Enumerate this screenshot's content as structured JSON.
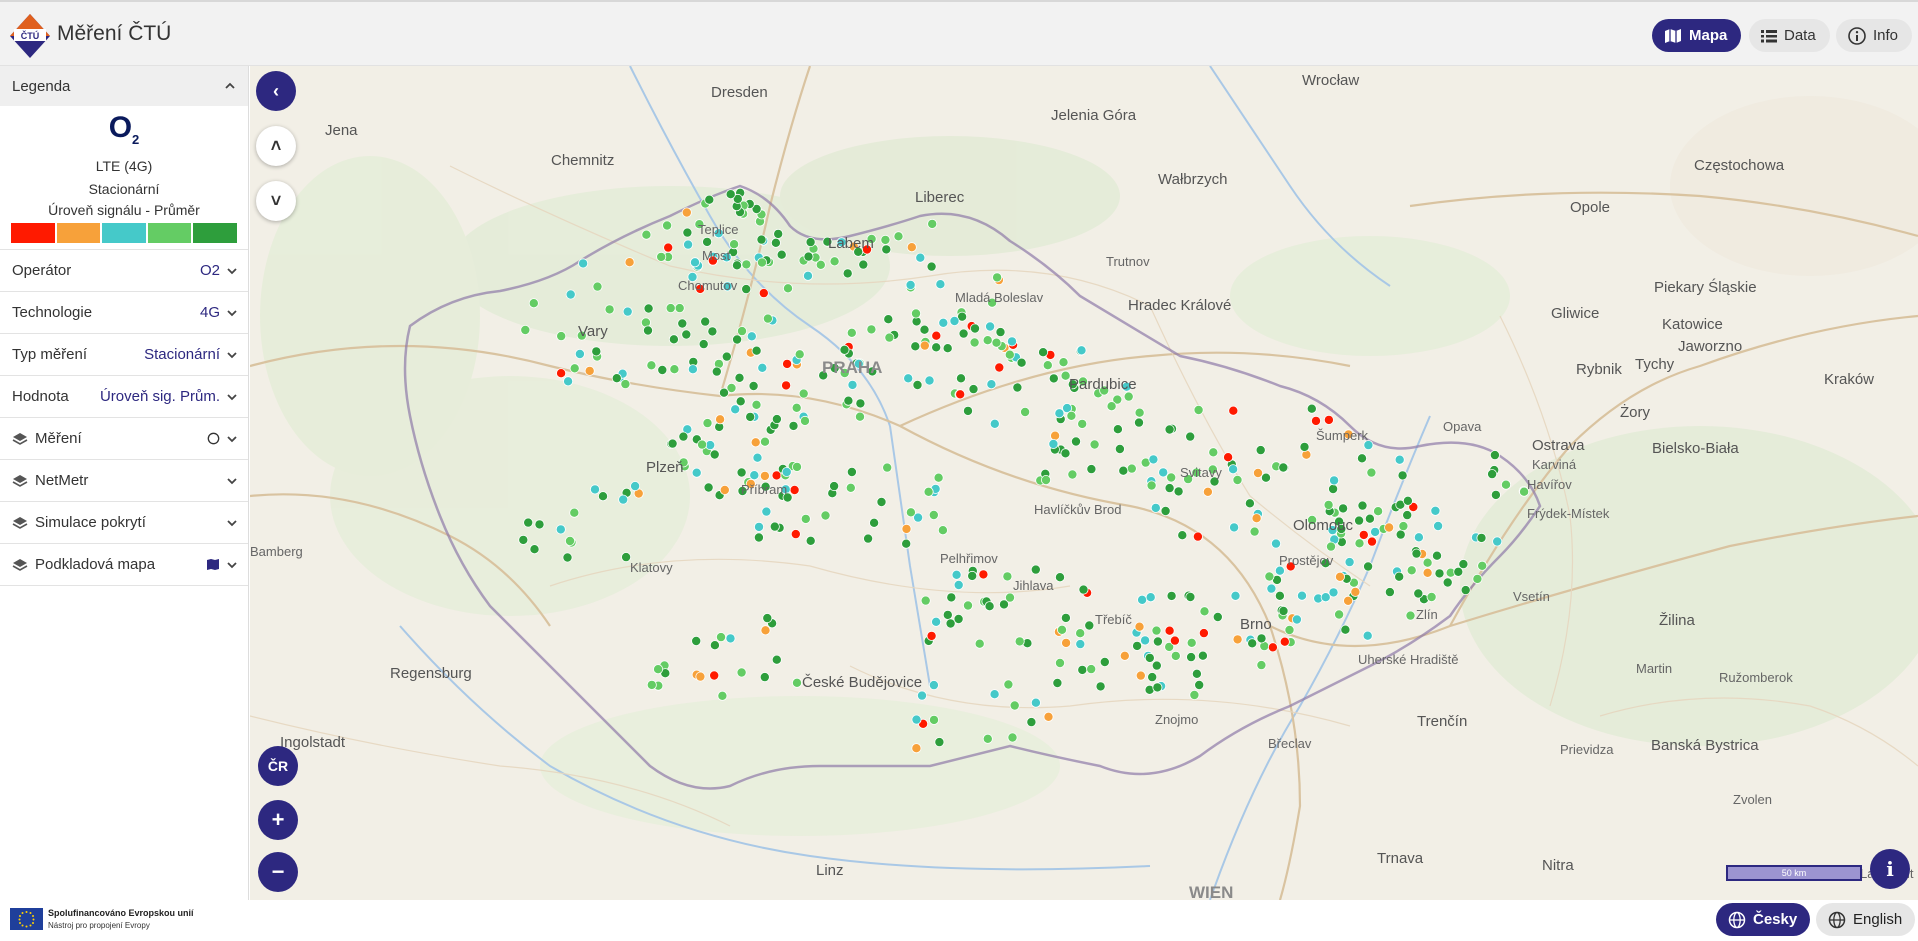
{
  "header": {
    "title": "Měření ČTÚ",
    "logo_text": "ČTÚ",
    "nav": [
      {
        "label": "Mapa",
        "icon": "map-icon",
        "active": true
      },
      {
        "label": "Data",
        "icon": "list-icon",
        "active": false
      },
      {
        "label": "Info",
        "icon": "info-icon",
        "active": false
      }
    ]
  },
  "legend": {
    "title": "Legenda",
    "operator_logo": "O",
    "operator_logo_sub": "2",
    "technology": "LTE (4G)",
    "measurement_type": "Stacionární",
    "metric": "Úroveň signálu - Průměr",
    "scale_colors": [
      "#ff1a00",
      "#f7a13a",
      "#45c9c9",
      "#64cc64",
      "#2e9e3c"
    ]
  },
  "filters": [
    {
      "label": "Operátor",
      "value": "O2"
    },
    {
      "label": "Technologie",
      "value": "4G"
    },
    {
      "label": "Typ měření",
      "value": "Stacionární"
    },
    {
      "label": "Hodnota",
      "value": "Úroveň sig. Prům."
    }
  ],
  "layers": [
    {
      "label": "Měření",
      "extra_icon": "circle-outline-icon"
    },
    {
      "label": "NetMetr",
      "extra_icon": ""
    },
    {
      "label": "Simulace pokrytí",
      "extra_icon": ""
    },
    {
      "label": "Podkladová mapa",
      "extra_icon": "map-book-icon"
    }
  ],
  "map": {
    "controls": {
      "collapse": "‹",
      "up": "˄",
      "down": "˅",
      "country": "ČR",
      "zoom_in": "+",
      "zoom_out": "−",
      "info": "i"
    },
    "scale_label": "50 km",
    "cities": [
      "Dresden",
      "Wrocław",
      "Jelenia Góra",
      "Chemnitz",
      "Wałbrzych",
      "Częstochowa",
      "Jena",
      "Opole",
      "Liberec",
      "Labem",
      "Teplice",
      "Most",
      "Chomutov",
      "Vary",
      "Mladá Boleslav",
      "Hradec Králové",
      "Trutnov",
      "Piekary Śląskie",
      "Gliwice",
      "Katowice",
      "Rybnik",
      "Jaworzno",
      "Tychy",
      "PRAHA",
      "Pardubice",
      "Kraków",
      "Żory",
      "Šumperk",
      "Opava",
      "Ostrava",
      "Bielsko-Biała",
      "Karviná",
      "Havířov",
      "Plzeň",
      "Příbram",
      "Havlíčkův Brod",
      "Svitavy",
      "Olomouc",
      "Frýdek-Místek",
      "Klatovy",
      "Pelhřimov",
      "Prostějov",
      "Jihlava",
      "Vsetín",
      "Zlín",
      "Třebíč",
      "Brno",
      "Žilina",
      "Regensburg",
      "České Budějovice",
      "Uherské Hradiště",
      "Martin",
      "Ružomberok",
      "Znojmo",
      "Břeclav",
      "Trenčín",
      "Prievidza",
      "Banská Bystrica",
      "Ingolstadt",
      "Zvolen",
      "Linz",
      "Trnava",
      "Nitra",
      "WIEN",
      "Landshut",
      "Bamberg"
    ]
  },
  "footer": {
    "eu_line1": "Spolufinancováno Evropskou unií",
    "eu_line2": "Nástroj pro propojení Evropy",
    "languages": [
      {
        "label": "Česky",
        "active": true
      },
      {
        "label": "English",
        "active": false
      }
    ]
  }
}
